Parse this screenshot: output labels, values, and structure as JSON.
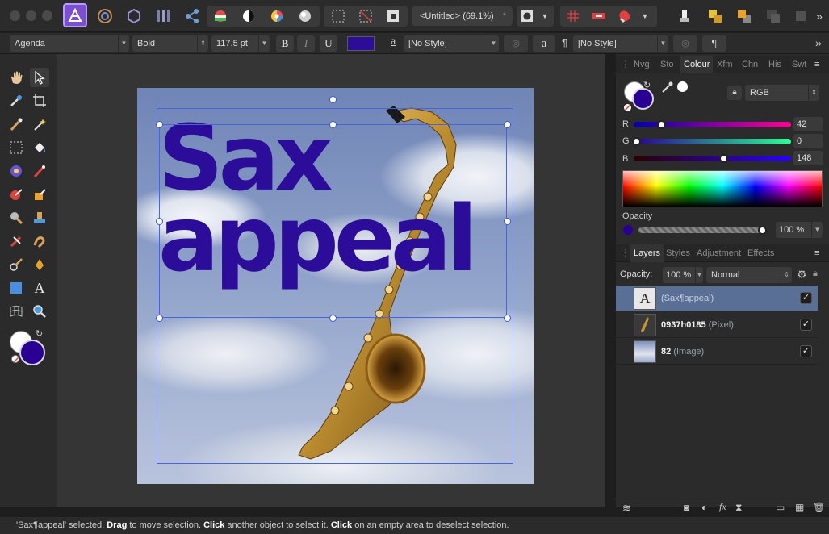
{
  "document": {
    "title": "<Untitled> (69.1%)",
    "modified_mark": "*"
  },
  "text_toolbar": {
    "font_family": "Agenda",
    "font_style": "Bold",
    "font_size": "117.5 pt",
    "bold": "B",
    "italic": "I",
    "underline": "U",
    "fill_color": "#2c0d9a",
    "char_style_icon": "a",
    "char_style": "[No Style]",
    "char_a": "a",
    "para_mark": "¶",
    "para_style": "[No Style]",
    "para_btn": "¶"
  },
  "canvas": {
    "text_line1": "Sax",
    "text_line2": "appeal",
    "text_color": "#2c0d9a"
  },
  "studio_tabs": [
    "Nvg",
    "Sto",
    "Colour",
    "Xfm",
    "Chn",
    "His",
    "Swt"
  ],
  "colour": {
    "model": "RGB",
    "r_label": "R",
    "r_value": "42",
    "g_label": "G",
    "g_value": "0",
    "b_label": "B",
    "b_value": "148",
    "r_fraction": 0.165,
    "g_fraction": 0.0,
    "b_fraction": 0.58,
    "current": "#2a0094",
    "opacity_label": "Opacity",
    "opacity_value": "100 %"
  },
  "layers_tabs": [
    "Layers",
    "Styles",
    "Adjustment",
    "Effects"
  ],
  "layers_panel": {
    "opacity_label": "Opacity:",
    "opacity_value": "100 %",
    "blend_mode": "Normal"
  },
  "layers": [
    {
      "name": "(Sax¶appeal)",
      "kind": "",
      "visible": "✓"
    },
    {
      "name": "0937h0185",
      "kind": "(Pixel)",
      "visible": "✓"
    },
    {
      "name": "82",
      "kind": "(Image)",
      "visible": "✓"
    }
  ],
  "status": {
    "p1": "'Sax¶appeal' selected. ",
    "b1": "Drag",
    "p2": " to move selection. ",
    "b2": "Click",
    "p3": " another object to select it. ",
    "b3": "Click",
    "p4": " on an empty area to deselect selection."
  }
}
